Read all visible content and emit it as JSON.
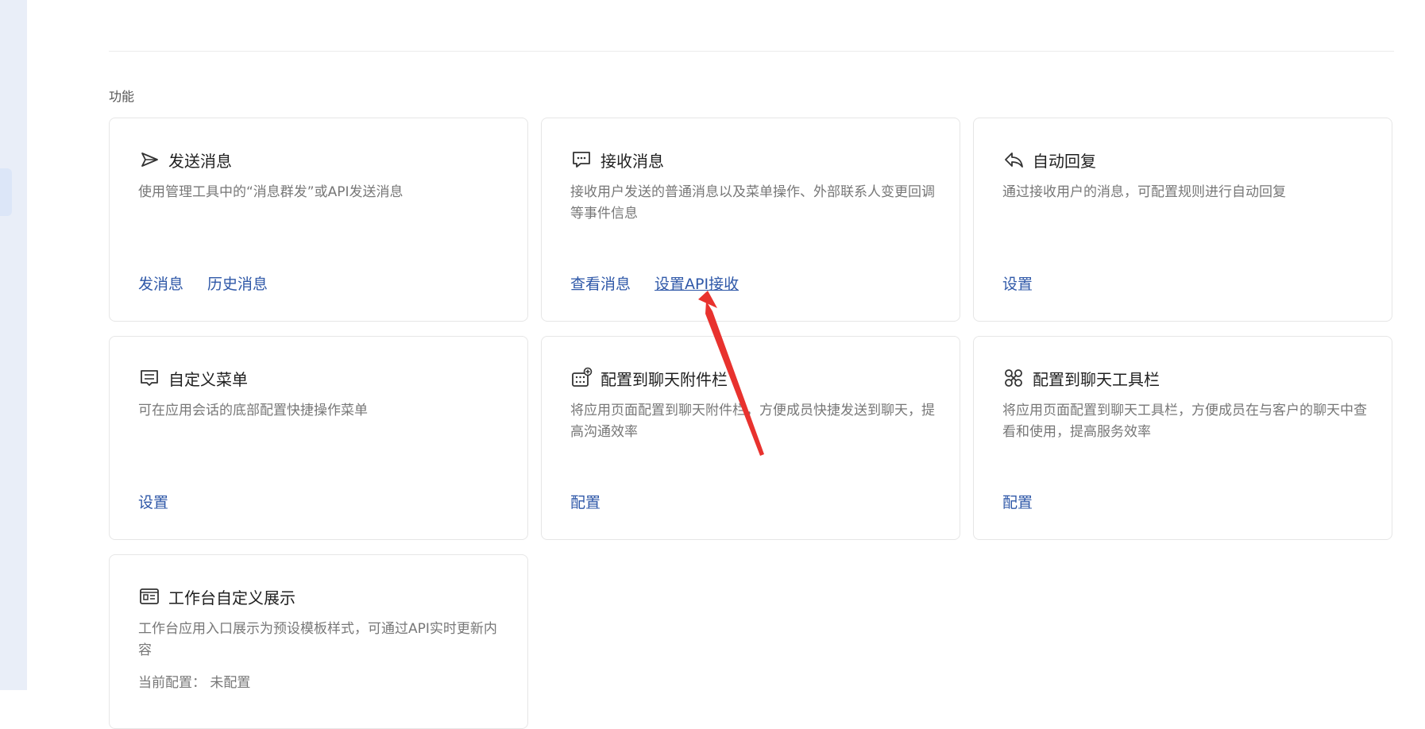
{
  "section": {
    "label": "功能"
  },
  "cards": [
    {
      "title": "发送消息",
      "icon": "send-icon",
      "desc": "使用管理工具中的“消息群发”或API发送消息",
      "actions": [
        "发消息",
        "历史消息"
      ]
    },
    {
      "title": "接收消息",
      "icon": "message-icon",
      "desc": "接收用户发送的普通消息以及菜单操作、外部联系人变更回调等事件信息",
      "actions": [
        "查看消息",
        "设置API接收"
      ]
    },
    {
      "title": "自动回复",
      "icon": "reply-icon",
      "desc": "通过接收用户的消息，可配置规则进行自动回复",
      "actions": [
        "设置"
      ]
    },
    {
      "title": "自定义菜单",
      "icon": "menu-icon",
      "desc": "可在应用会话的底部配置快捷操作菜单",
      "actions": [
        "设置"
      ]
    },
    {
      "title": "配置到聊天附件栏",
      "icon": "attachment-grid-icon",
      "desc": "将应用页面配置到聊天附件栏，方便成员快捷发送到聊天，提高沟通效率",
      "actions": [
        "配置"
      ]
    },
    {
      "title": "配置到聊天工具栏",
      "icon": "toolbar-icon",
      "desc": "将应用页面配置到聊天工具栏，方便成员在与客户的聊天中查看和使用，提高服务效率",
      "actions": [
        "配置"
      ]
    },
    {
      "title": "工作台自定义展示",
      "icon": "workbench-card-icon",
      "desc": "工作台应用入口展示为预设模板样式，可通过API实时更新内容",
      "status_label": "当前配置：",
      "status_value": "未配置"
    }
  ],
  "colors": {
    "link": "#2f58a8",
    "annotation_arrow": "#e8322e",
    "rail": "#e9eef8"
  }
}
